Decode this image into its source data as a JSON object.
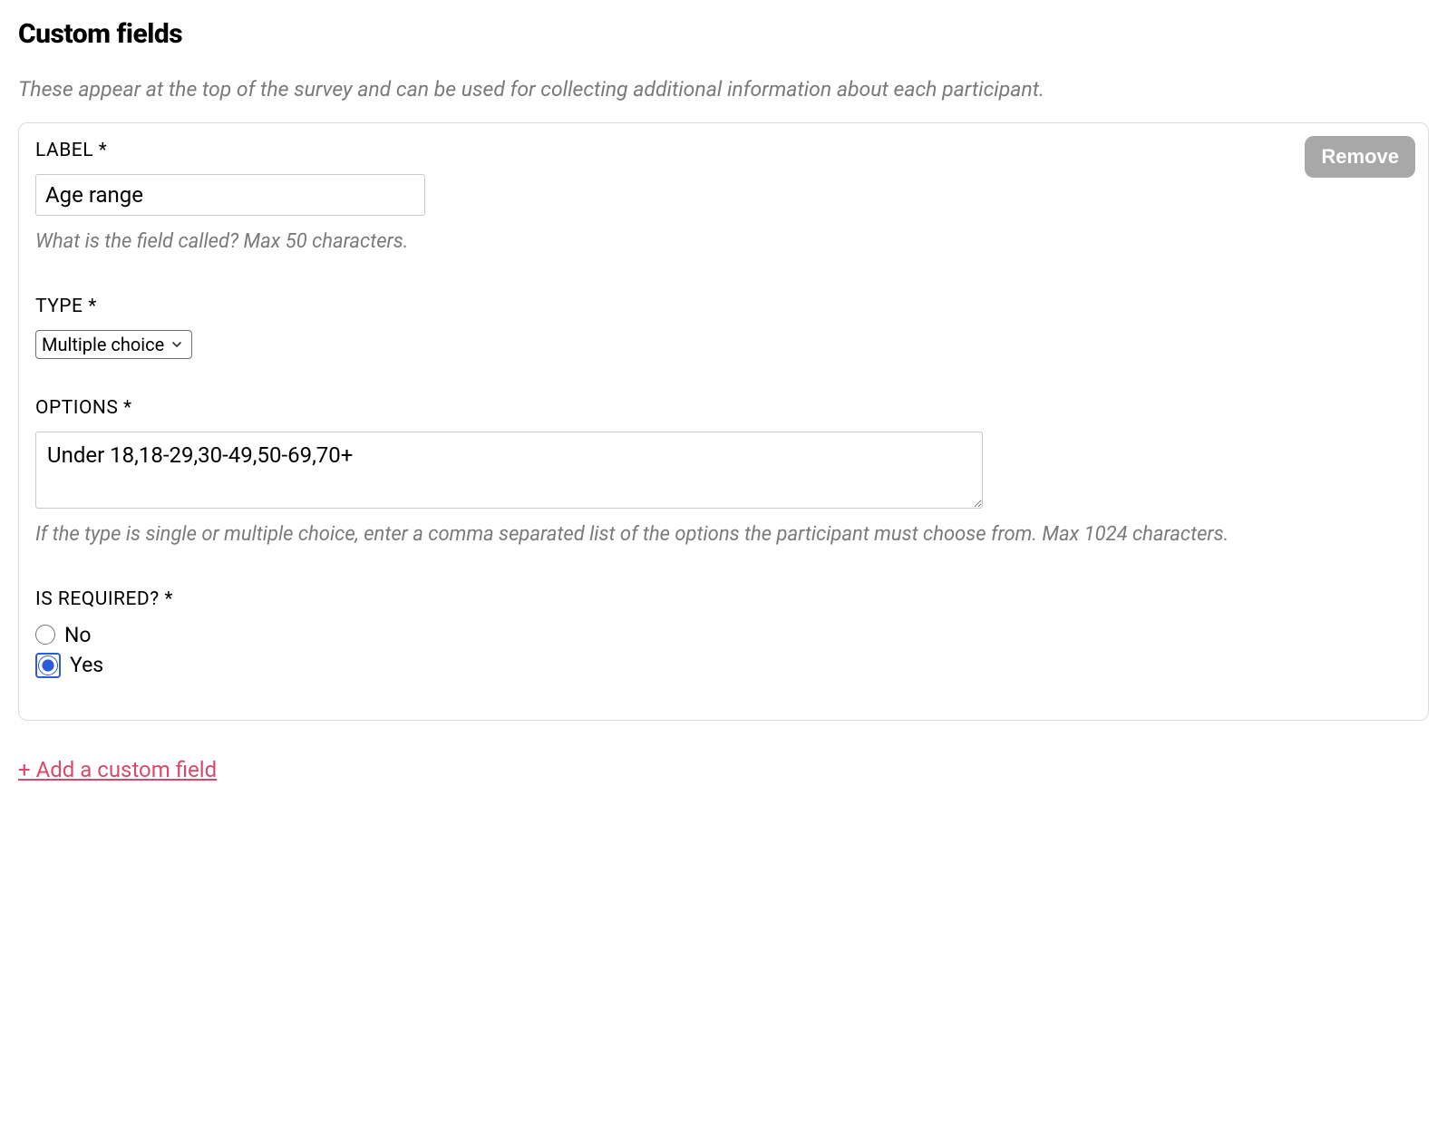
{
  "page": {
    "title": "Custom fields",
    "description": "These appear at the top of the survey and can be used for collecting additional information about each participant."
  },
  "field": {
    "remove_label": "Remove",
    "label_field": {
      "label": "LABEL *",
      "value": "Age range",
      "help": "What is the field called? Max 50 characters."
    },
    "type_field": {
      "label": "TYPE *",
      "value": "Multiple choice"
    },
    "options_field": {
      "label": "OPTIONS *",
      "value": "Under 18,18-29,30-49,50-69,70+",
      "help": "If the type is single or multiple choice, enter a comma separated list of the options the participant must choose from. Max 1024 characters."
    },
    "required_field": {
      "label": "IS REQUIRED? *",
      "no_label": "No",
      "yes_label": "Yes",
      "selected": "yes"
    }
  },
  "add_link": "+ Add a custom field"
}
